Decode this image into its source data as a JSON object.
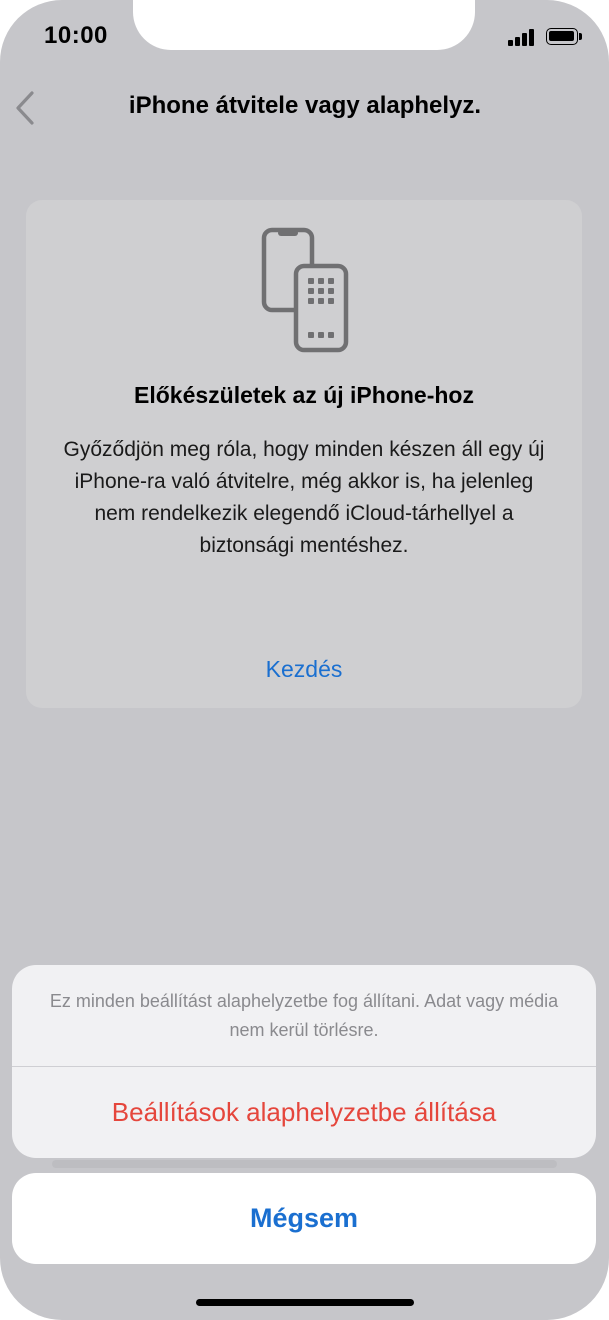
{
  "status_bar": {
    "time": "10:00"
  },
  "nav": {
    "title": "iPhone átvitele vagy alaphelyz.",
    "back_icon": "chevron-left-icon"
  },
  "prepare_card": {
    "icon": "two-phones-transfer-icon",
    "title": "Előkészületek az új iPhone-hoz",
    "body": "Győződjön meg róla, hogy minden készen áll egy új iPhone-ra való átvitelre, még akkor is, ha jelenleg nem rendelkezik elegendő iCloud-tárhellyel a biztonsági mentéshez.",
    "link_label": "Kezdés"
  },
  "action_sheet": {
    "message": "Ez minden beállítást alaphelyzetbe fog állítani. Adat vagy média nem kerül törlésre.",
    "destructive_action": "Beállítások alaphelyzetbe állítása",
    "cancel_label": "Mégsem"
  },
  "colors": {
    "accent_blue": "#1a6fd0",
    "destructive_red": "#e5463c",
    "dimmed_background": "#c6c6ca"
  }
}
